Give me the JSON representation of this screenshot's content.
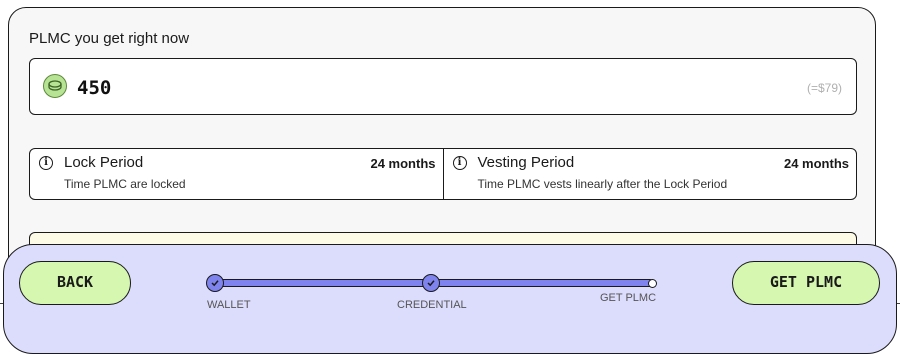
{
  "purchase": {
    "heading": "PLMC you get right now",
    "amount": "450",
    "usd_equivalent": "(=$79)",
    "token_icon": "plmc-coin-icon"
  },
  "lock_period": {
    "title": "Lock Period",
    "value": "24 months",
    "description": "Time PLMC are locked",
    "icon": "info-icon"
  },
  "vesting_period": {
    "title": "Vesting Period",
    "value": "24 months",
    "description": "Time PLMC vests linearly after the Lock Period",
    "icon": "info-icon"
  },
  "footer": {
    "back_label": "BACK",
    "get_label": "GET PLMC",
    "steps": [
      {
        "label": "WALLET",
        "status": "complete",
        "icon": "check-icon"
      },
      {
        "label": "CREDENTIAL",
        "status": "complete",
        "icon": "check-icon"
      },
      {
        "label": "GET PLMC",
        "status": "pending"
      }
    ],
    "progress_fraction": 1.0
  },
  "colors": {
    "accent_green": "#d6f7b0",
    "accent_purple": "#7e83ee",
    "footer_bg": "#dcdcfd",
    "notice_bg": "#fdfbe6"
  }
}
